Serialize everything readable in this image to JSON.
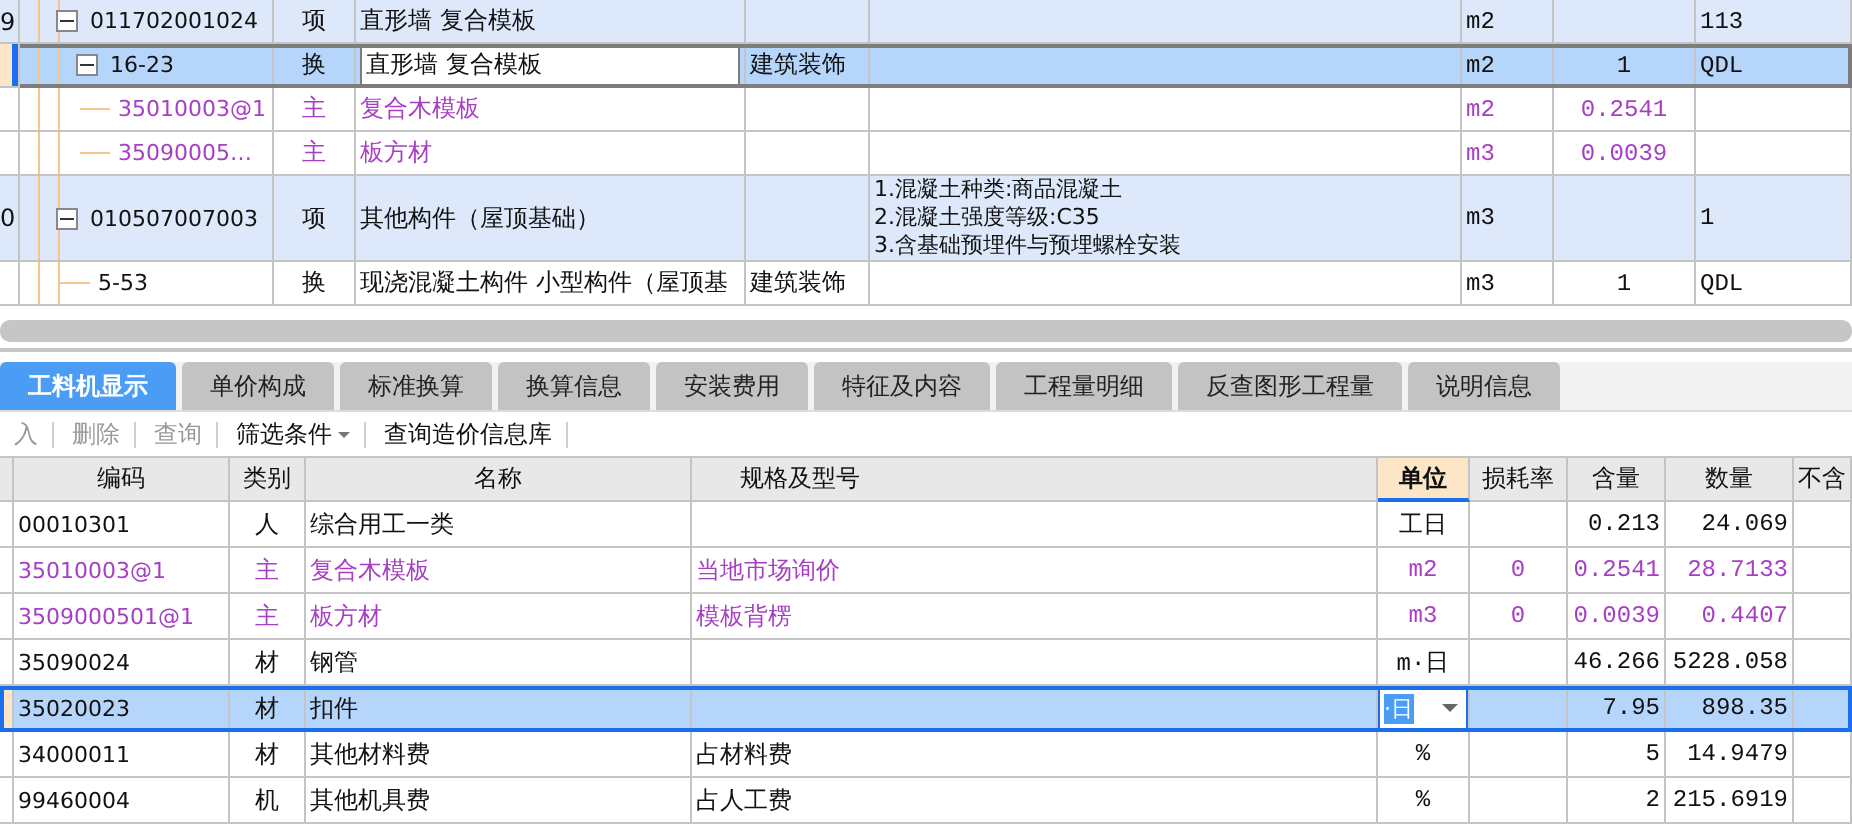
{
  "upper_grid": {
    "rows": [
      {
        "row_number": "9",
        "code": "011702001024",
        "expanded": true,
        "kind": "item",
        "type": "项",
        "name": "直形墙 复合模板",
        "unit": "m2",
        "column_9": "113",
        "selected": false,
        "children": [
          {
            "code": "16-23",
            "expanded": true,
            "kind": "quota",
            "type": "换",
            "name": "直形墙 复合模板",
            "specialty": "建筑装饰",
            "unit": "m2",
            "quantity": "1",
            "column_9": "QDL",
            "selected": true,
            "children": [
              {
                "code": "35010003@1",
                "kind": "main",
                "type": "主",
                "name": "复合木模板",
                "unit": "m2",
                "quantity": "0.2541",
                "selected": false
              },
              {
                "code": "35090005…",
                "kind": "main",
                "type": "主",
                "name": "板方材",
                "unit": "m3",
                "quantity": "0.0039",
                "selected": false
              }
            ]
          }
        ]
      },
      {
        "row_number": "0",
        "code": "010507007003",
        "expanded": true,
        "kind": "item",
        "type": "项",
        "name": "其他构件（屋顶基础）",
        "description": [
          "1.混凝土种类:商品混凝土",
          "2.混凝土强度等级:C35",
          "3.含基础预埋件与预埋螺栓安装"
        ],
        "unit": "m3",
        "column_9": "1",
        "selected": false,
        "children": [
          {
            "code": "5-53",
            "kind": "quota",
            "type": "换",
            "name": "现浇混凝土构件 小型构件（屋顶基",
            "specialty": "建筑装饰",
            "unit": "m3",
            "quantity": "1",
            "column_9": "QDL",
            "selected": false
          }
        ]
      }
    ]
  },
  "tabs": [
    {
      "label": "工料机显示",
      "selected": true
    },
    {
      "label": "单价构成",
      "selected": false
    },
    {
      "label": "标准换算",
      "selected": false
    },
    {
      "label": "换算信息",
      "selected": false
    },
    {
      "label": "安装费用",
      "selected": false
    },
    {
      "label": "特征及内容",
      "selected": false
    },
    {
      "label": "工程量明细",
      "selected": false
    },
    {
      "label": "反查图形工程量",
      "selected": false
    },
    {
      "label": "说明信息",
      "selected": false
    }
  ],
  "toolbar": [
    {
      "label": "入",
      "disabled": true,
      "dropdown": false
    },
    {
      "label": "删除",
      "disabled": true,
      "dropdown": false
    },
    {
      "label": "查询",
      "disabled": true,
      "dropdown": false
    },
    {
      "label": "筛选条件",
      "disabled": false,
      "dropdown": true
    },
    {
      "label": "查询造价信息库",
      "disabled": false,
      "dropdown": false
    }
  ],
  "lower_grid": {
    "columns": [
      {
        "label": "编码",
        "selected": false
      },
      {
        "label": "类别",
        "selected": false
      },
      {
        "label": "名称",
        "selected": false
      },
      {
        "label": "规格及型号",
        "selected": false
      },
      {
        "label": "单位",
        "selected": true
      },
      {
        "label": "损耗率",
        "selected": false
      },
      {
        "label": "含量",
        "selected": false
      },
      {
        "label": "数量",
        "selected": false
      },
      {
        "label": "不含",
        "selected": false
      }
    ],
    "rows": [
      {
        "code": "00010301",
        "kind": "labor",
        "type": "人",
        "name": "综合用工一类",
        "unit": "工日",
        "content": "0.213",
        "quantity": "24.069",
        "selected": false
      },
      {
        "code": "35010003@1",
        "kind": "main",
        "type": "主",
        "name": "复合木模板",
        "spec": "当地市场询价",
        "unit": "m2",
        "loss_rate": "0",
        "content": "0.2541",
        "quantity": "28.7133",
        "selected": false
      },
      {
        "code": "3509000501@1",
        "kind": "main",
        "type": "主",
        "name": "板方材",
        "spec": "模板背楞",
        "unit": "m3",
        "loss_rate": "0",
        "content": "0.0039",
        "quantity": "0.4407",
        "selected": false
      },
      {
        "code": "35090024",
        "kind": "material",
        "type": "材",
        "name": "钢管",
        "unit": "m·日",
        "content": "46.266",
        "quantity": "5228.058",
        "selected": false
      },
      {
        "code": "35020023",
        "kind": "material",
        "type": "材",
        "name": "扣件",
        "unit": "·日",
        "content": "7.95",
        "quantity": "898.35",
        "selected": true
      },
      {
        "code": "34000011",
        "kind": "material",
        "type": "材",
        "name": "其他材料费",
        "spec": "占材料费",
        "unit": "%",
        "content": "5",
        "quantity": "14.9479",
        "selected": false
      },
      {
        "code": "99460004",
        "kind": "machine",
        "type": "机",
        "name": "其他机具费",
        "spec": "占人工费",
        "unit": "%",
        "content": "2",
        "quantity": "215.6919",
        "selected": false
      }
    ]
  }
}
